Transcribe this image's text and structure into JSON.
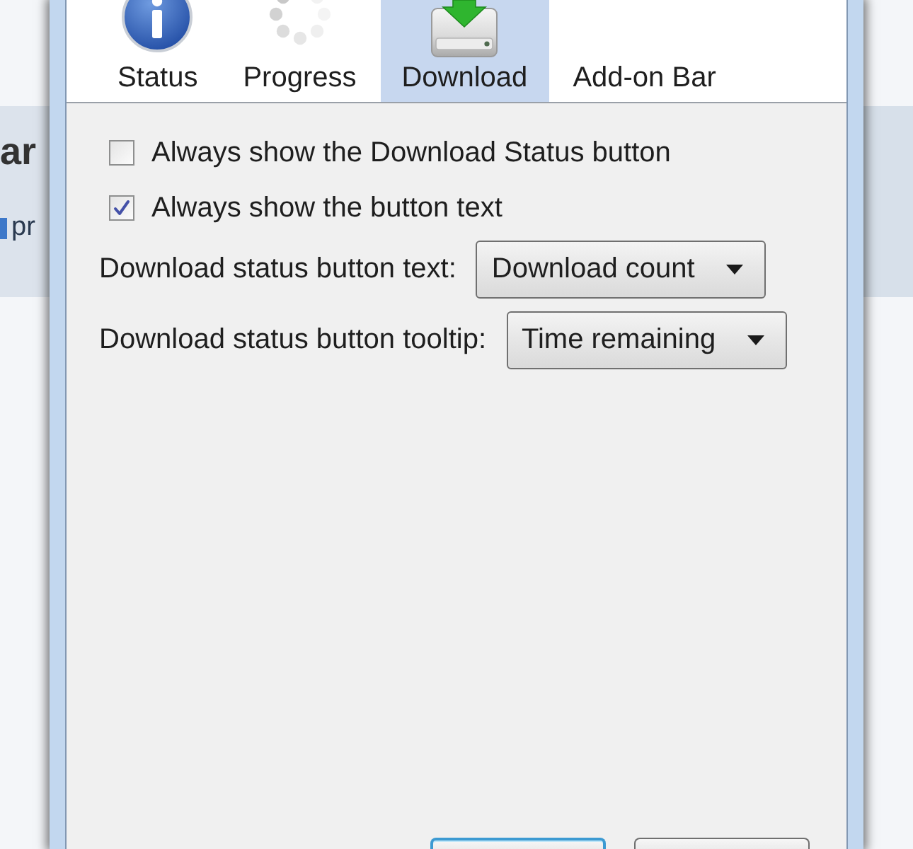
{
  "background_app": {
    "heading": "ar",
    "text": "pr"
  },
  "tabs": [
    {
      "label": "Status",
      "selected": false,
      "kind": "info"
    },
    {
      "label": "Progress",
      "selected": false,
      "kind": "spinner"
    },
    {
      "label": "Download",
      "selected": true,
      "kind": "drive"
    },
    {
      "label": "Add-on Bar",
      "selected": false,
      "kind": "plain"
    }
  ],
  "options": [
    {
      "label": "Always show the Download Status button",
      "checked": false
    },
    {
      "label": "Always show the button text",
      "checked": true
    }
  ],
  "dropdowns": [
    {
      "label": "Download status button text:",
      "value": "Download count"
    },
    {
      "label": "Download status button tooltip:",
      "value": "Time remaining"
    }
  ],
  "buttons": [
    {
      "default": true
    },
    {
      "default": false
    }
  ]
}
